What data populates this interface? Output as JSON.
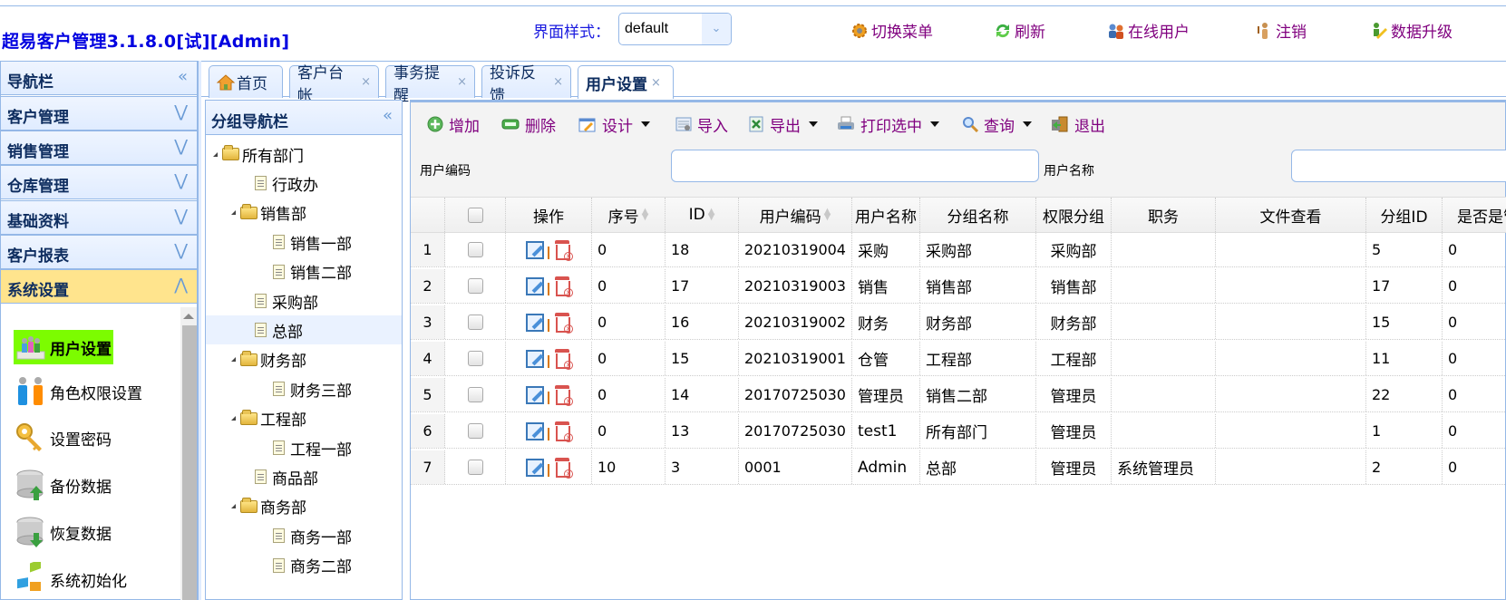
{
  "header": {
    "app_title": "超易客户管理3.1.8.0[试][Admin]",
    "theme_label": "界面样式：",
    "theme_value": "default",
    "links": [
      {
        "label": "切换菜单",
        "icon": "gear-icon"
      },
      {
        "label": "刷新",
        "icon": "refresh-icon"
      },
      {
        "label": "在线用户",
        "icon": "online-users-icon"
      },
      {
        "label": "注销",
        "icon": "logout-icon"
      },
      {
        "label": "数据升级",
        "icon": "upgrade-icon"
      }
    ]
  },
  "nav": {
    "title": "导航栏",
    "sections": [
      "客户管理",
      "销售管理",
      "仓库管理",
      "基础资料",
      "客户报表",
      "系统设置"
    ],
    "active_section": "系统设置",
    "items": [
      {
        "label": "用户设置",
        "icon": "users-icon",
        "selected": true
      },
      {
        "label": "角色权限设置",
        "icon": "roles-icon"
      },
      {
        "label": "设置密码",
        "icon": "key-icon"
      },
      {
        "label": "备份数据",
        "icon": "backup-icon"
      },
      {
        "label": "恢复数据",
        "icon": "restore-icon"
      },
      {
        "label": "系统初始化",
        "icon": "init-icon"
      }
    ]
  },
  "tabs": [
    {
      "label": "首页",
      "closable": false
    },
    {
      "label": "客户台帐",
      "closable": true
    },
    {
      "label": "事务提醒",
      "closable": true
    },
    {
      "label": "投诉反馈",
      "closable": true
    },
    {
      "label": "用户设置",
      "closable": true,
      "active": true
    }
  ],
  "tab_close": "×",
  "group": {
    "title": "分组导航栏",
    "tree": [
      {
        "label": "所有部门",
        "type": "folder",
        "level": 0
      },
      {
        "label": "行政办",
        "type": "file",
        "level": 1
      },
      {
        "label": "销售部",
        "type": "folder",
        "level": 1
      },
      {
        "label": "销售一部",
        "type": "file",
        "level": 2
      },
      {
        "label": "销售二部",
        "type": "file",
        "level": 2
      },
      {
        "label": "采购部",
        "type": "file",
        "level": 1
      },
      {
        "label": "总部",
        "type": "file",
        "level": 1,
        "highlight": true
      },
      {
        "label": "财务部",
        "type": "folder",
        "level": 1
      },
      {
        "label": "财务三部",
        "type": "file",
        "level": 2
      },
      {
        "label": "工程部",
        "type": "folder",
        "level": 1
      },
      {
        "label": "工程一部",
        "type": "file",
        "level": 2
      },
      {
        "label": "商品部",
        "type": "file",
        "level": 1
      },
      {
        "label": "商务部",
        "type": "folder",
        "level": 1
      },
      {
        "label": "商务一部",
        "type": "file",
        "level": 2
      },
      {
        "label": "商务二部",
        "type": "file",
        "level": 2
      }
    ]
  },
  "toolbar": {
    "add": "增加",
    "delete": "删除",
    "design": "设计",
    "import": "导入",
    "export": "导出",
    "print": "打印选中",
    "query": "查询",
    "exit": "退出"
  },
  "filters": {
    "user_code_label": "用户编码",
    "user_code_value": "",
    "user_name_label": "用户名称",
    "user_name_value": ""
  },
  "grid": {
    "columns": [
      "操作",
      "序号",
      "ID",
      "用户编码",
      "用户名称",
      "分组名称",
      "权限分组",
      "职务",
      "文件查看",
      "分组ID",
      "是否是管"
    ],
    "rows": [
      {
        "no": "1",
        "seq": "0",
        "id": "18",
        "code": "20210319004",
        "name": "采购",
        "group": "采购部",
        "perm": "采购部",
        "title": "",
        "files": "",
        "gid": "5",
        "flag": "0"
      },
      {
        "no": "2",
        "seq": "0",
        "id": "17",
        "code": "20210319003",
        "name": "销售",
        "group": "销售部",
        "perm": "销售部",
        "title": "",
        "files": "",
        "gid": "17",
        "flag": "0"
      },
      {
        "no": "3",
        "seq": "0",
        "id": "16",
        "code": "20210319002",
        "name": "财务",
        "group": "财务部",
        "perm": "财务部",
        "title": "",
        "files": "",
        "gid": "15",
        "flag": "0"
      },
      {
        "no": "4",
        "seq": "0",
        "id": "15",
        "code": "20210319001",
        "name": "仓管",
        "group": "工程部",
        "perm": "工程部",
        "title": "",
        "files": "",
        "gid": "11",
        "flag": "0"
      },
      {
        "no": "5",
        "seq": "0",
        "id": "14",
        "code": "20170725030",
        "name": "管理员",
        "group": "销售二部",
        "perm": "管理员",
        "title": "",
        "files": "",
        "gid": "22",
        "flag": "0"
      },
      {
        "no": "6",
        "seq": "0",
        "id": "13",
        "code": "20170725030",
        "name": "test1",
        "group": "所有部门",
        "perm": "管理员",
        "title": "",
        "files": "",
        "gid": "1",
        "flag": "0"
      },
      {
        "no": "7",
        "seq": "10",
        "id": "3",
        "code": "0001",
        "name": "Admin",
        "group": "总部",
        "perm": "管理员",
        "title": "系统管理员",
        "files": "",
        "gid": "2",
        "flag": "0"
      }
    ]
  }
}
